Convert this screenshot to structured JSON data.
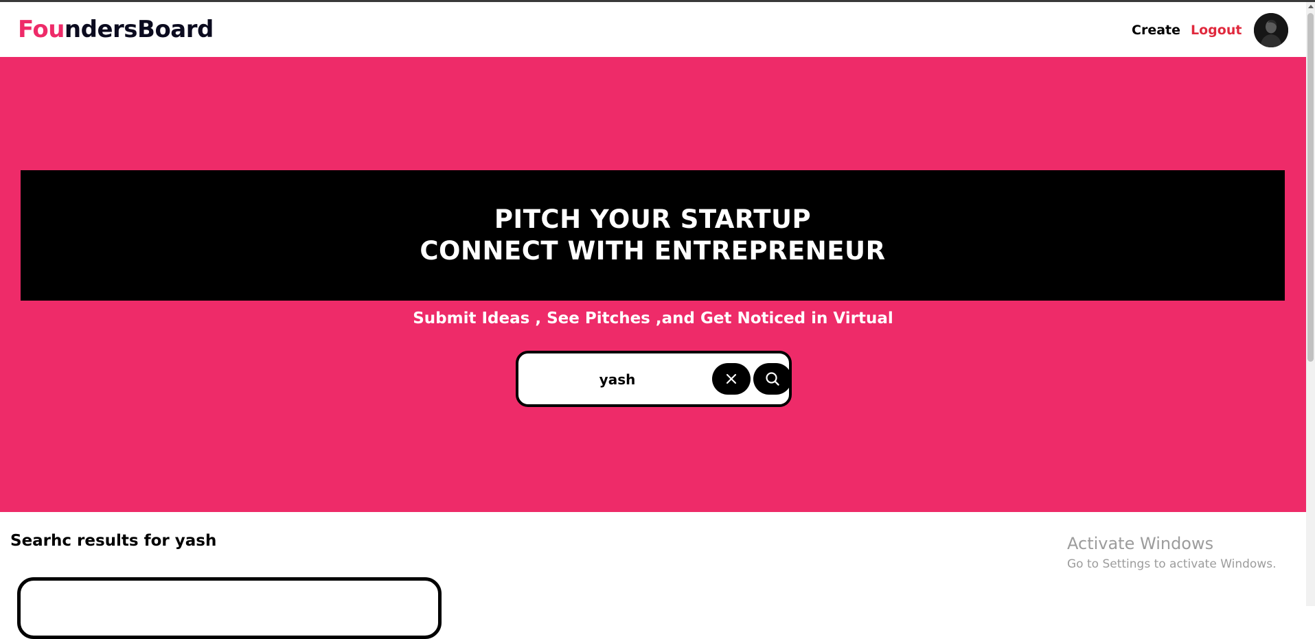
{
  "header": {
    "logo_accent": "Fou",
    "logo_rest": "ndersBoard",
    "nav": {
      "create": "Create",
      "logout": "Logout"
    },
    "avatar_icon": "user-avatar-icon"
  },
  "hero": {
    "heading_line1": "PITCH YOUR STARTUP",
    "heading_line2": "CONNECT WITH ENTREPRENEUR",
    "subheading": "Submit Ideas , See Pitches ,and Get Noticed in Virtual",
    "search": {
      "value": "yash",
      "clear_icon": "close-icon",
      "search_icon": "search-icon"
    }
  },
  "results": {
    "title": "Searhc results for yash"
  },
  "watermark": {
    "title": "Activate Windows",
    "subtitle": "Go to Settings to activate Windows."
  },
  "colors": {
    "brand_pink": "#ee2b69",
    "logout_red": "#e0293d",
    "banner_black": "#000000"
  }
}
